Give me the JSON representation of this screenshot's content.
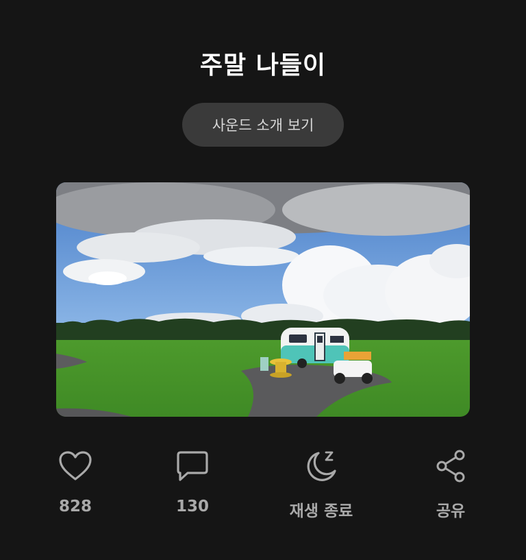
{
  "header": {
    "title": "주말 나들이"
  },
  "intro_button": {
    "label": "사운드 소개 보기"
  },
  "photo": {
    "description_icon": "camper-landscape-image"
  },
  "actions": [
    {
      "icon": "heart-icon",
      "label": "828"
    },
    {
      "icon": "comment-icon",
      "label": "130"
    },
    {
      "icon": "sleep-timer-icon",
      "label": "재생 종료"
    },
    {
      "icon": "share-icon",
      "label": "공유"
    }
  ],
  "colors": {
    "background": "#151515",
    "pill": "#3a3a3a",
    "icon": "#a9a9a9"
  }
}
